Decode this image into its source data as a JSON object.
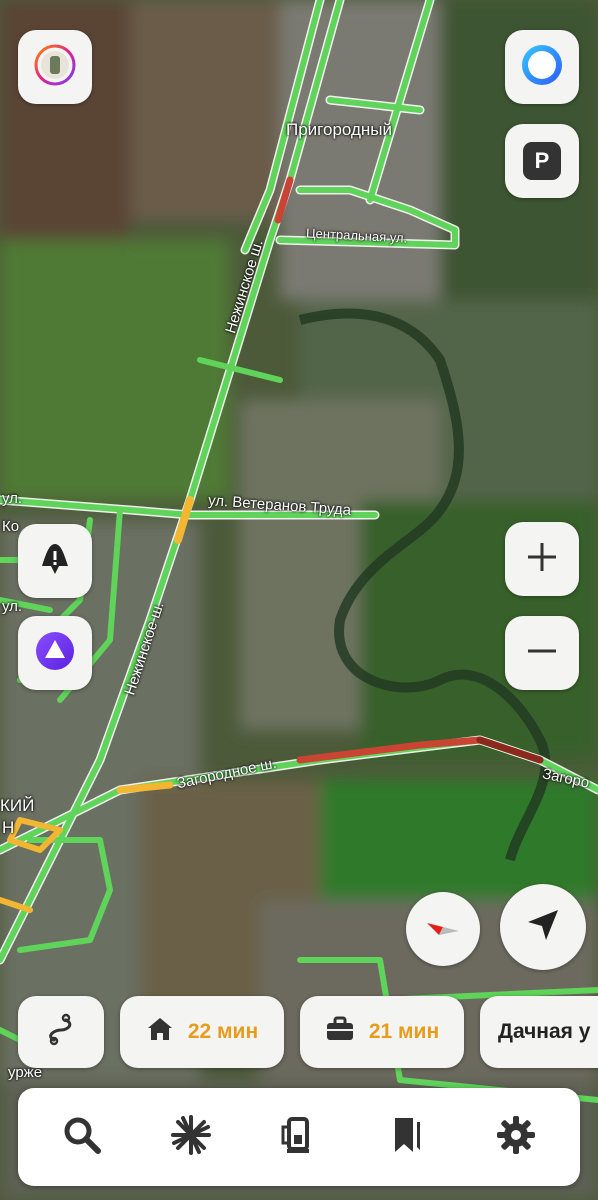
{
  "map": {
    "labels": {
      "place_prigorodny": "Пригородный",
      "street_centralnaya": "Центральная ул.",
      "street_nezhinskoe_top": "Нежинское ш.",
      "street_veteranov": "ул. Ветеранов Труда",
      "street_nezhinskoe_bottom": "Нежинское ш.",
      "street_zagorodnoe": "Загородное ш.",
      "street_zagorodnoe_right": "Загоро",
      "partial_ul_1": "ул.",
      "partial_ko": "Ко",
      "partial_ul_2": "ул.",
      "partial_kiy": "КИЙ",
      "partial_n": "Н",
      "partial_urzhye": "урже"
    }
  },
  "controls": {
    "left": [
      "stories-icon",
      "alert-icon",
      "alice-icon"
    ],
    "right": [
      "profile-icon",
      "parking-icon",
      "zoom-in-icon",
      "zoom-out-icon",
      "compass-icon",
      "locate-icon"
    ],
    "parking_letter": "P"
  },
  "chips": {
    "home": {
      "icon": "home-icon",
      "value": "22 мин"
    },
    "work": {
      "icon": "briefcase-icon",
      "value": "21 мин"
    },
    "place": {
      "label": "Дачная у"
    }
  },
  "tabs": [
    "search-icon",
    "sparkle-icon",
    "fuel-icon",
    "bookmarks-icon",
    "settings-icon"
  ],
  "colors": {
    "traffic_free": "#5fd35a",
    "traffic_slow": "#f2b632",
    "traffic_jam": "#c94433",
    "traffic_heavy": "#8a2a1c",
    "accent": "#e89b1c"
  }
}
